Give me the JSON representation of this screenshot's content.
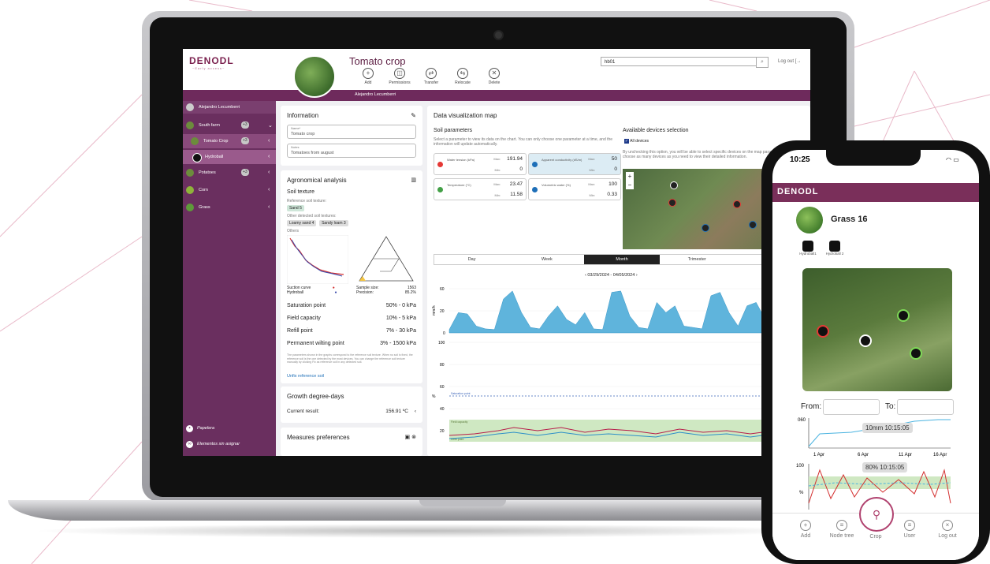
{
  "app": {
    "logo": "DENODL",
    "logo_sub": "~Early access~",
    "crop_title": "Tomato crop",
    "tools": [
      "Add",
      "Permissions",
      "Transfer",
      "Relocate",
      "Delete"
    ],
    "search_value": "hb01",
    "logout": "Log out",
    "user": "Alejandro Lecumberri"
  },
  "sidebar": {
    "user": "Alejandro Lecumberri",
    "items": [
      {
        "label": "South farm",
        "count": "+3",
        "chev": "⌄"
      },
      {
        "label": "Tomato Crop",
        "count": "+3",
        "chev": "‹"
      },
      {
        "label": "Hydroball",
        "count": "",
        "chev": "‹"
      },
      {
        "label": "Potatoes",
        "count": "+3",
        "chev": "‹"
      },
      {
        "label": "Corn",
        "count": "",
        "chev": "‹"
      },
      {
        "label": "Grass",
        "count": "",
        "chev": "‹"
      }
    ],
    "bottom": [
      "Papelera",
      "Elementos sin asignar"
    ]
  },
  "information": {
    "title": "Information",
    "name_label": "Name*",
    "name_value": "Tomato crop",
    "notes_label": "Notes",
    "notes_value": "Tomatoes from august"
  },
  "agronomical": {
    "title": "Agronomical analysis",
    "soil_texture": "Soil texture",
    "reference_label": "Reference soil texture:",
    "reference_chip": "Sand",
    "reference_count": "5",
    "other_label": "Other detected soil textures:",
    "other_chips": [
      "Loamy sand",
      "Sandy loam"
    ],
    "other_counts": [
      "4",
      "3"
    ],
    "others": "Others",
    "legend_suction": "Suction curve",
    "legend_hydroball": "Hydroball",
    "sample_size_label": "Sample size:",
    "sample_size": "1563",
    "precision_label": "Precision:",
    "precision": "85.2%",
    "rows": [
      {
        "k": "Saturation point",
        "v": "50% - 0 kPa"
      },
      {
        "k": "Field capacity",
        "v": "10% - 5 kPa"
      },
      {
        "k": "Refill point",
        "v": "7% - 30 kPa"
      },
      {
        "k": "Permanent wilting point",
        "v": "3% - 1500 kPa"
      }
    ],
    "footnote": "The parameters shown in the graphs correspond to the reference soil texture. When no soil is fixed, the reference soil is the one detected by the most devices. You can change the reference soil texture manually by clicking Fix as reference soil in any detected soil.",
    "unfix": "Unfix reference soil"
  },
  "growth": {
    "title": "Growth degree-days",
    "label": "Current result:",
    "value": "156.91 ºC"
  },
  "measures": {
    "title": "Measures preferences"
  },
  "viz": {
    "title": "Data visualization map",
    "soil_params": "Soil parameters",
    "desc": "Select a parameter to view its data on the chart. You can only choose one parameter at a time, and the information will update automatically.",
    "params": [
      {
        "name": "Water tension (kPa)",
        "max": "191.94",
        "min": "0",
        "color": "#e53935"
      },
      {
        "name": "Apparent conductivity (dS/m)",
        "max": "50",
        "min": "0",
        "color": "#1e6fb8"
      },
      {
        "name": "Temperature (°C)",
        "max": "23.47",
        "min": "11.58",
        "color": "#43a047"
      },
      {
        "name": "Volumetric water (%)",
        "max": "100",
        "min": "0.33",
        "color": "#1e6fb8"
      }
    ],
    "max_label": "Max:",
    "min_label": "Min:",
    "available": "Available devices selection",
    "all_devices": "All devices",
    "available_desc": "By unchecking this option, you will be able to select specific devices on the map parameters. You can choose as many devices as you need to view their detailed information.",
    "tabs": [
      "Day",
      "Week",
      "Month",
      "Trimester",
      ""
    ],
    "active_tab": "Month",
    "date_range": "‹  03/29/2024 - 04/05/2024  ›",
    "y1_label": "mm/h",
    "y1_ticks": [
      "60",
      "20",
      "0"
    ],
    "y2_label": "%",
    "y2_ticks": [
      "100",
      "80",
      "60",
      "40",
      "20"
    ],
    "ann_saturation": "Saturation point",
    "ann_field": "Field capacity",
    "ann_refill": "Refill point"
  },
  "phone": {
    "time": "10:25",
    "logo": "DENODL",
    "name": "Grass 16",
    "devices": [
      "Hydroball1",
      "Hydroball 2"
    ],
    "from": "From:",
    "to": "To:",
    "tip1": "10mm 10:15:05",
    "tip2": "80% 10:15:05",
    "x_ticks": [
      "1 Apr",
      "6 Apr",
      "11 Apr",
      "16 Apr"
    ],
    "y_ticks_1": [
      "060"
    ],
    "y_ticks_2": [
      "100"
    ],
    "y2_label": "%",
    "nav": [
      "Add",
      "Node tree",
      "Crop",
      "User",
      "Log out"
    ]
  },
  "chart_data": {
    "type": "area",
    "x": [
      0,
      1,
      2,
      3,
      4,
      5,
      6,
      7,
      8,
      9,
      10,
      11,
      12,
      13,
      14,
      15,
      16,
      17,
      18,
      19,
      20,
      21,
      22,
      23,
      24,
      25,
      26,
      27,
      28,
      29,
      30,
      31,
      32,
      33,
      34,
      35,
      36,
      37,
      38,
      39,
      40
    ],
    "series": [
      {
        "values": [
          5,
          30,
          28,
          10,
          6,
          5,
          50,
          62,
          30,
          8,
          6,
          25,
          40,
          20,
          12,
          30,
          6,
          5,
          60,
          62,
          25,
          8,
          6,
          45,
          30,
          40,
          10,
          8,
          6,
          55,
          60,
          30,
          10,
          40,
          45,
          20,
          25,
          10,
          5,
          4,
          5
        ]
      }
    ],
    "ylabel": "mm/h",
    "ylim": [
      0,
      70
    ]
  }
}
